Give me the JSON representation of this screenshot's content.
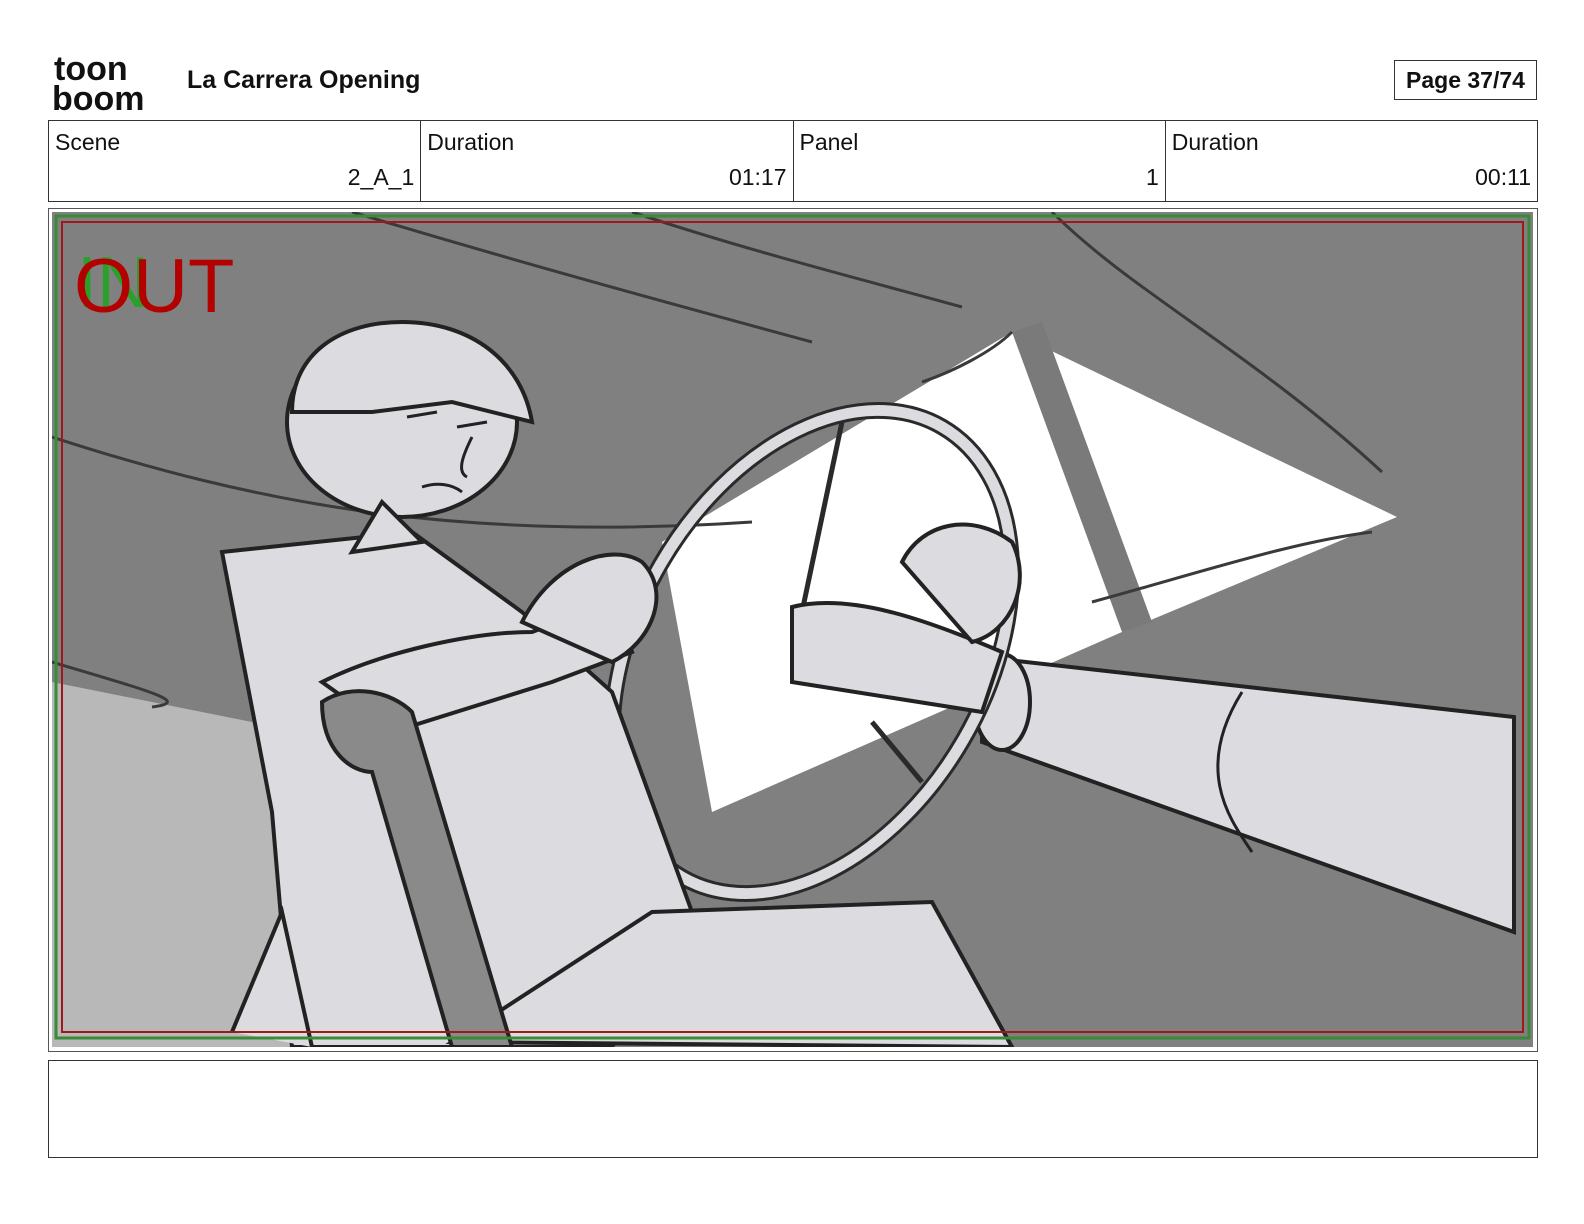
{
  "header": {
    "logo_text_top": "toon",
    "logo_text_bottom": "boom",
    "title": "La Carrera Opening",
    "page_label": "Page 37/74"
  },
  "info": {
    "scene_label": "Scene",
    "scene_value": "2_A_1",
    "scene_duration_label": "Duration",
    "scene_duration_value": "01:17",
    "panel_label": "Panel",
    "panel_value": "1",
    "panel_duration_label": "Duration",
    "panel_duration_value": "00:11"
  },
  "panel": {
    "in_marker": "IN",
    "out_marker": "OUT",
    "colors": {
      "background": "#808080",
      "figure": "#dcdce0",
      "sky": "#ffffff",
      "outline": "#2a2a2a",
      "out_marker": "#b30000",
      "in_marker": "#2aa02a",
      "frame_green": "#3a8a3a",
      "frame_red": "#a01818"
    }
  },
  "notes": {
    "text": ""
  }
}
